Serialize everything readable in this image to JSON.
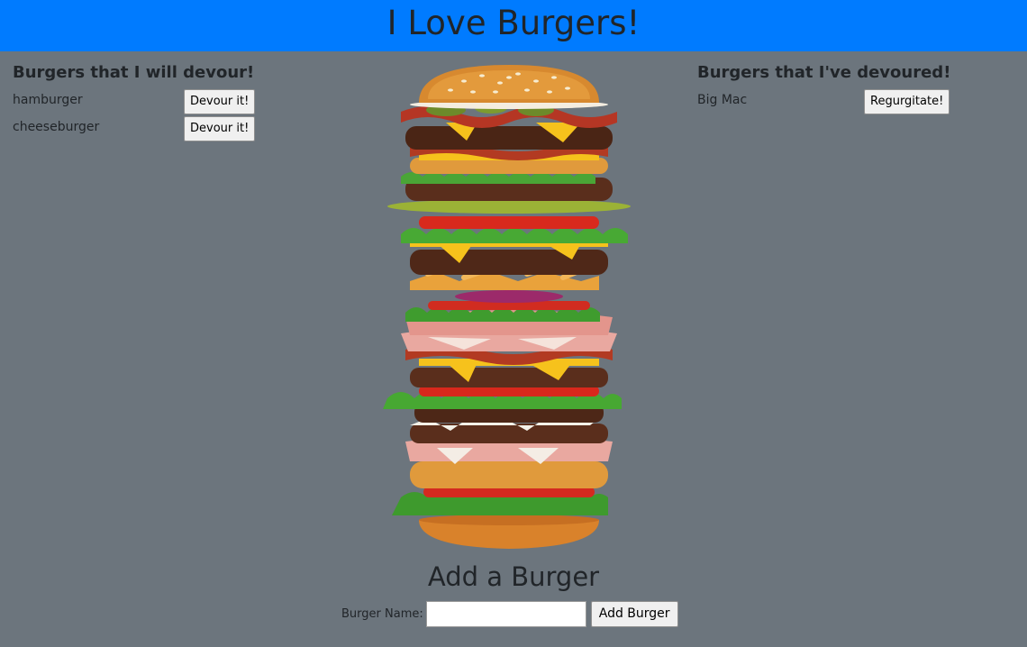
{
  "header": {
    "title": "I Love Burgers!"
  },
  "left_column": {
    "heading": "Burgers that I will devour!",
    "items": [
      {
        "name": "hamburger",
        "button_label": "Devour it!"
      },
      {
        "name": "cheeseburger",
        "button_label": "Devour it!"
      }
    ]
  },
  "right_column": {
    "heading": "Burgers that I've devoured!",
    "items": [
      {
        "name": "Big Mac",
        "button_label": "Regurgitate!"
      }
    ]
  },
  "add_section": {
    "title": "Add a Burger",
    "field_label": "Burger Name:",
    "field_value": "",
    "field_placeholder": "",
    "button_label": "Add Burger"
  },
  "colors": {
    "banner": "#007bff",
    "background": "#6c757d",
    "text": "#212529"
  }
}
